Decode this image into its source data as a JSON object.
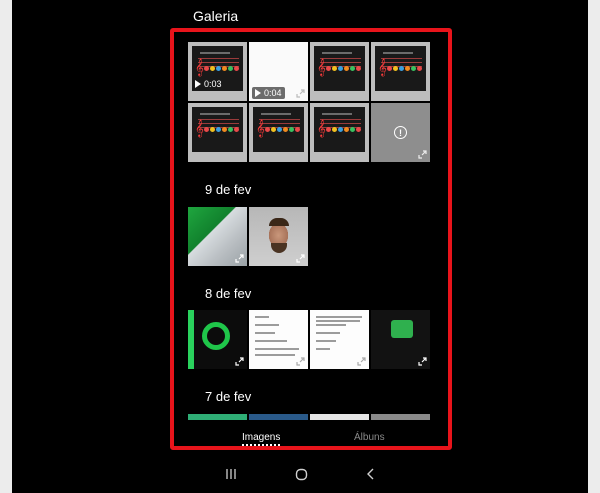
{
  "app": {
    "title": "Galeria"
  },
  "grid": {
    "row1": [
      {
        "kind": "video",
        "duration": "0:03"
      },
      {
        "kind": "video",
        "duration": "0:04"
      },
      {
        "kind": "image"
      },
      {
        "kind": "image"
      }
    ],
    "row2": [
      {
        "kind": "image"
      },
      {
        "kind": "image"
      },
      {
        "kind": "image"
      },
      {
        "kind": "error"
      }
    ]
  },
  "sections": [
    {
      "date": "9 de fev"
    },
    {
      "date": "8 de fev"
    },
    {
      "date": "7 de fev"
    }
  ],
  "tabs": {
    "images": "Imagens",
    "albums": "Álbuns"
  },
  "colors": {
    "highlight": "#e8141b",
    "background": "#000000",
    "accent_green": "#1fc64a"
  },
  "icons": {
    "play": "play-icon",
    "expand": "expand-icon",
    "alert": "alert-icon",
    "recents": "recents-icon",
    "home": "home-icon",
    "back": "back-icon"
  }
}
